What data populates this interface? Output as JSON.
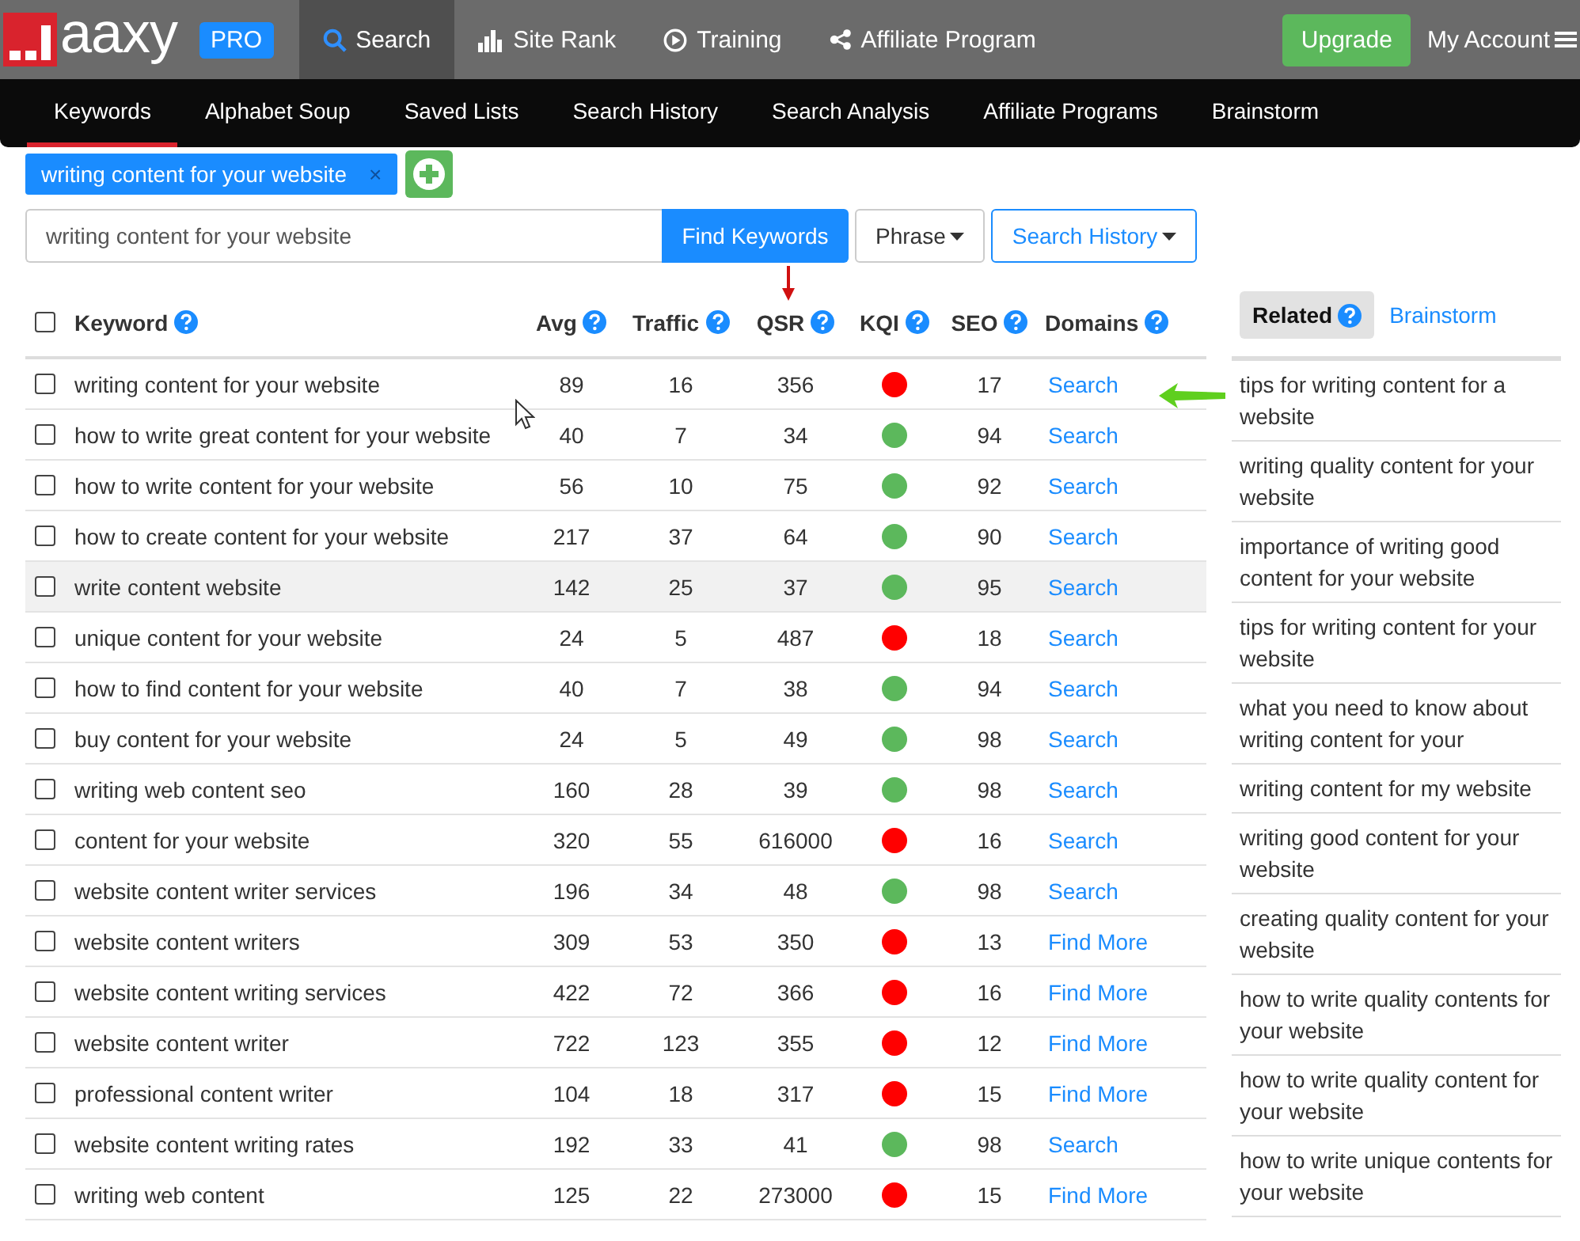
{
  "topbar": {
    "logo": "aaxy",
    "badge": "PRO",
    "nav": [
      {
        "label": "Search",
        "selected": true
      },
      {
        "label": "Site Rank",
        "selected": false
      },
      {
        "label": "Training",
        "selected": false
      },
      {
        "label": "Affiliate Program",
        "selected": false
      }
    ],
    "upgrade": "Upgrade",
    "account": "My Account"
  },
  "subnav": [
    {
      "label": "Keywords",
      "selected": true
    },
    {
      "label": "Alphabet Soup",
      "selected": false
    },
    {
      "label": "Saved Lists",
      "selected": false
    },
    {
      "label": "Search History",
      "selected": false
    },
    {
      "label": "Search Analysis",
      "selected": false
    },
    {
      "label": "Affiliate Programs",
      "selected": false
    },
    {
      "label": "Brainstorm",
      "selected": false
    }
  ],
  "search_tag": {
    "label": "writing content for your website",
    "close": "×"
  },
  "search": {
    "value": "writing content for your website",
    "find_button": "Find Keywords",
    "phrase_button": "Phrase",
    "history_button": "Search History"
  },
  "table": {
    "select_all_checked": false,
    "columns": [
      "Keyword",
      "Avg",
      "Traffic",
      "QSR",
      "KQI",
      "SEO",
      "Domains"
    ],
    "rows": [
      {
        "keyword": "writing content for your website",
        "avg": "89",
        "traffic": "16",
        "qsr": "356",
        "color": "#ff0000",
        "seo": "17",
        "domains": "Search",
        "checked": false,
        "highlighted": false
      },
      {
        "keyword": "how to write great content for your website",
        "avg": "40",
        "traffic": "7",
        "qsr": "34",
        "color": "#5cb85c",
        "seo": "94",
        "domains": "Search",
        "checked": false,
        "highlighted": false
      },
      {
        "keyword": "how to write content for your website",
        "avg": "56",
        "traffic": "10",
        "qsr": "75",
        "color": "#5cb85c",
        "seo": "92",
        "domains": "Search",
        "checked": false,
        "highlighted": false
      },
      {
        "keyword": "how to create content for your website",
        "avg": "217",
        "traffic": "37",
        "qsr": "64",
        "color": "#5cb85c",
        "seo": "90",
        "domains": "Search",
        "checked": false,
        "highlighted": false
      },
      {
        "keyword": "write content website",
        "avg": "142",
        "traffic": "25",
        "qsr": "37",
        "color": "#5cb85c",
        "seo": "95",
        "domains": "Search",
        "checked": false,
        "highlighted": true
      },
      {
        "keyword": "unique content for your website",
        "avg": "24",
        "traffic": "5",
        "qsr": "487",
        "color": "#ff0000",
        "seo": "18",
        "domains": "Search",
        "checked": false,
        "highlighted": false
      },
      {
        "keyword": "how to find content for your website",
        "avg": "40",
        "traffic": "7",
        "qsr": "38",
        "color": "#5cb85c",
        "seo": "94",
        "domains": "Search",
        "checked": false,
        "highlighted": false
      },
      {
        "keyword": "buy content for your website",
        "avg": "24",
        "traffic": "5",
        "qsr": "49",
        "color": "#5cb85c",
        "seo": "98",
        "domains": "Search",
        "checked": false,
        "highlighted": false
      },
      {
        "keyword": "writing web content seo",
        "avg": "160",
        "traffic": "28",
        "qsr": "39",
        "color": "#5cb85c",
        "seo": "98",
        "domains": "Search",
        "checked": false,
        "highlighted": false
      },
      {
        "keyword": "content for your website",
        "avg": "320",
        "traffic": "55",
        "qsr": "616000",
        "color": "#ff0000",
        "seo": "16",
        "domains": "Search",
        "checked": false,
        "highlighted": false
      },
      {
        "keyword": "website content writer services",
        "avg": "196",
        "traffic": "34",
        "qsr": "48",
        "color": "#5cb85c",
        "seo": "98",
        "domains": "Search",
        "checked": false,
        "highlighted": false
      },
      {
        "keyword": "website content writers",
        "avg": "309",
        "traffic": "53",
        "qsr": "350",
        "color": "#ff0000",
        "seo": "13",
        "domains": "Find More",
        "checked": false,
        "highlighted": false
      },
      {
        "keyword": "website content writing services",
        "avg": "422",
        "traffic": "72",
        "qsr": "366",
        "color": "#ff0000",
        "seo": "16",
        "domains": "Find More",
        "checked": false,
        "highlighted": false
      },
      {
        "keyword": "website content writer",
        "avg": "722",
        "traffic": "123",
        "qsr": "355",
        "color": "#ff0000",
        "seo": "12",
        "domains": "Find More",
        "checked": false,
        "highlighted": false
      },
      {
        "keyword": "professional content writer",
        "avg": "104",
        "traffic": "18",
        "qsr": "317",
        "color": "#ff0000",
        "seo": "15",
        "domains": "Find More",
        "checked": false,
        "highlighted": false
      },
      {
        "keyword": "website content writing rates",
        "avg": "192",
        "traffic": "33",
        "qsr": "41",
        "color": "#5cb85c",
        "seo": "98",
        "domains": "Search",
        "checked": false,
        "highlighted": false
      },
      {
        "keyword": "writing web content",
        "avg": "125",
        "traffic": "22",
        "qsr": "273000",
        "color": "#ff0000",
        "seo": "15",
        "domains": "Find More",
        "checked": false,
        "highlighted": false
      }
    ]
  },
  "sidebar": {
    "tabs": [
      {
        "label": "Related",
        "selected": true,
        "help": true
      },
      {
        "label": "Brainstorm",
        "selected": false,
        "help": false
      }
    ],
    "items": [
      "tips for writing content for a website",
      "writing quality content for your website",
      "importance of writing good content for your website",
      "tips for writing content for your website",
      "what you need to know about writing content for your",
      "writing content for my website",
      "writing good content for your website",
      "creating quality content for your website",
      "how to write quality contents for your website",
      "how to write quality content for your website",
      "how to write unique contents for your website"
    ]
  }
}
